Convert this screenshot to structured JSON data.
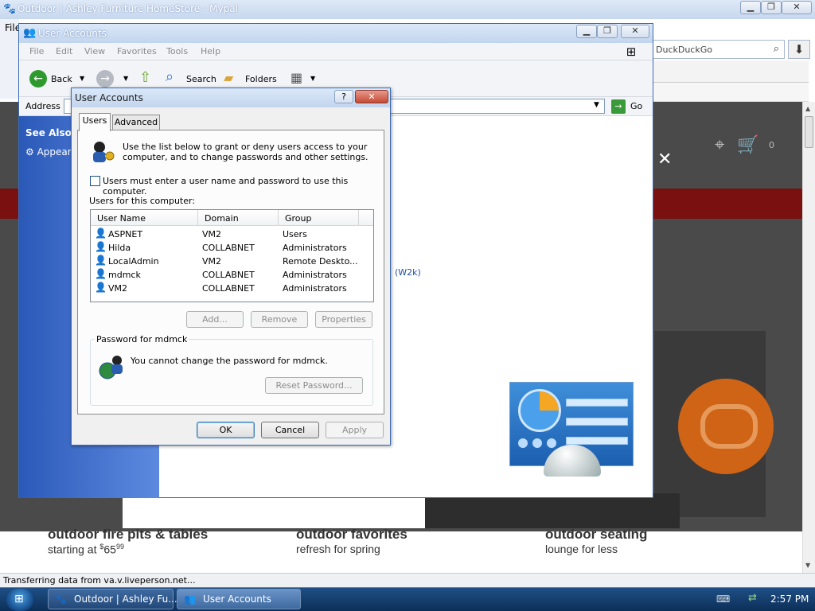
{
  "browser": {
    "title": "Outdoor | Ashley Furniture HomeStore - Mypal",
    "menu_first": "File",
    "search_engine": "DuckDuckGo",
    "status": "Transferring data from va.v.liveperson.net...",
    "cart_count": "0",
    "captions": [
      {
        "title": "outdoor fire pits & tables",
        "sub_prefix": "starting at ",
        "price_dollar": "$",
        "price_main": "65",
        "price_cents": "99"
      },
      {
        "title": "outdoor favorites",
        "sub": "refresh for spring"
      },
      {
        "title": "outdoor seating",
        "sub": "lounge for less"
      }
    ]
  },
  "explorer": {
    "title": "User Accounts",
    "menu": [
      "File",
      "Edit",
      "View",
      "Favorites",
      "Tools",
      "Help"
    ],
    "toolbar": {
      "back": "Back",
      "search": "Search",
      "folders": "Folders"
    },
    "address_label": "Address",
    "go_label": "Go",
    "see_also": "See Also",
    "sidebar_item": "Appear",
    "content_text": "(W2k)"
  },
  "dialog": {
    "title": "User Accounts",
    "tabs": [
      "Users",
      "Advanced"
    ],
    "intro": "Use the list below to grant or deny users access to your computer, and to change passwords and other settings.",
    "checkbox_label": "Users must enter a user name and password to use this computer.",
    "users_label": "Users for this computer:",
    "columns": [
      "User Name",
      "Domain",
      "Group"
    ],
    "rows": [
      {
        "name": "ASPNET",
        "domain": "VM2",
        "group": "Users"
      },
      {
        "name": "Hilda",
        "domain": "COLLABNET",
        "group": "Administrators"
      },
      {
        "name": "LocalAdmin",
        "domain": "VM2",
        "group": "Remote Deskto..."
      },
      {
        "name": "mdmck",
        "domain": "COLLABNET",
        "group": "Administrators"
      },
      {
        "name": "VM2",
        "domain": "COLLABNET",
        "group": "Administrators"
      }
    ],
    "buttons": {
      "add": "Add...",
      "remove": "Remove",
      "properties": "Properties",
      "reset": "Reset Password...",
      "ok": "OK",
      "cancel": "Cancel",
      "apply": "Apply"
    },
    "password_group": "Password for mdmck",
    "password_text": "You cannot change the password for mdmck."
  },
  "taskbar": {
    "items": [
      "Outdoor | Ashley Fu...",
      "User Accounts"
    ],
    "clock": "2:57 PM"
  }
}
